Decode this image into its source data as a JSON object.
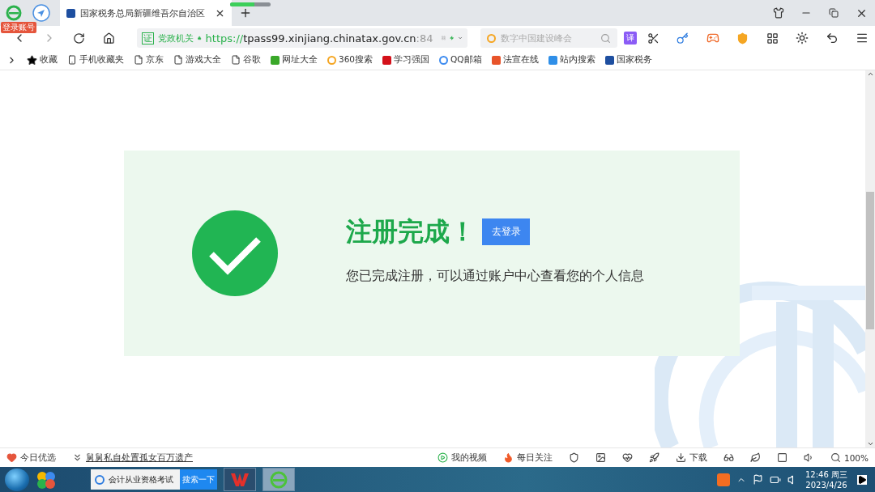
{
  "browser": {
    "account_badge": "登录账号",
    "tab": {
      "title": "国家税务总局新疆维吾尔自治区",
      "selected": true
    },
    "address": {
      "badge": "证",
      "badge_label": "党政机关",
      "scheme": "https://",
      "host": "tpass99.xinjiang.chinatax.gov.cn",
      "port": ":84"
    },
    "search": {
      "placeholder": "数字中国建设峰会"
    },
    "translate": "译"
  },
  "bookmarks": [
    {
      "kind": "star",
      "label": "收藏"
    },
    {
      "kind": "mobile",
      "label": "手机收藏夹"
    },
    {
      "kind": "page",
      "label": "京东"
    },
    {
      "kind": "page",
      "label": "游戏大全"
    },
    {
      "kind": "page",
      "label": "谷歌"
    },
    {
      "kind": "site",
      "label": "网址大全",
      "color": "#3aa829"
    },
    {
      "kind": "ring",
      "label": "360搜索",
      "color": "#f5a623"
    },
    {
      "kind": "site",
      "label": "学习强国",
      "color": "#d4111a"
    },
    {
      "kind": "ring",
      "label": "QQ邮箱",
      "color": "#3d8bf0"
    },
    {
      "kind": "site",
      "label": "法宣在线",
      "color": "#e8542a"
    },
    {
      "kind": "site",
      "label": "站内搜索",
      "color": "#2f8fe8"
    },
    {
      "kind": "tax",
      "label": "国家税务",
      "color": "#1e4fa0"
    }
  ],
  "content": {
    "title": "注册完成！",
    "login_button": "去登录",
    "message": "您已完成注册，可以通过账户中心查看您的个人信息"
  },
  "status_bar": {
    "left": [
      {
        "kind": "heart",
        "label": "今日优选"
      },
      {
        "kind": "news",
        "label": "舅舅私自处置孤女百万遗产"
      }
    ],
    "right": [
      {
        "kind": "video",
        "label": "我的视频"
      },
      {
        "kind": "fire",
        "label": "每日关注"
      },
      {
        "kind": "shield"
      },
      {
        "kind": "image"
      },
      {
        "kind": "pulse"
      },
      {
        "kind": "rocket"
      },
      {
        "kind": "download",
        "label": "下载"
      },
      {
        "kind": "glasses"
      },
      {
        "kind": "leaf"
      },
      {
        "kind": "window"
      },
      {
        "kind": "speaker"
      },
      {
        "kind": "zoom",
        "label": "100%"
      }
    ]
  },
  "taskbar": {
    "search": {
      "value": "会计从业资格考试",
      "button": "搜索一下"
    },
    "time": "12:46 周三",
    "date": "2023/4/26"
  }
}
